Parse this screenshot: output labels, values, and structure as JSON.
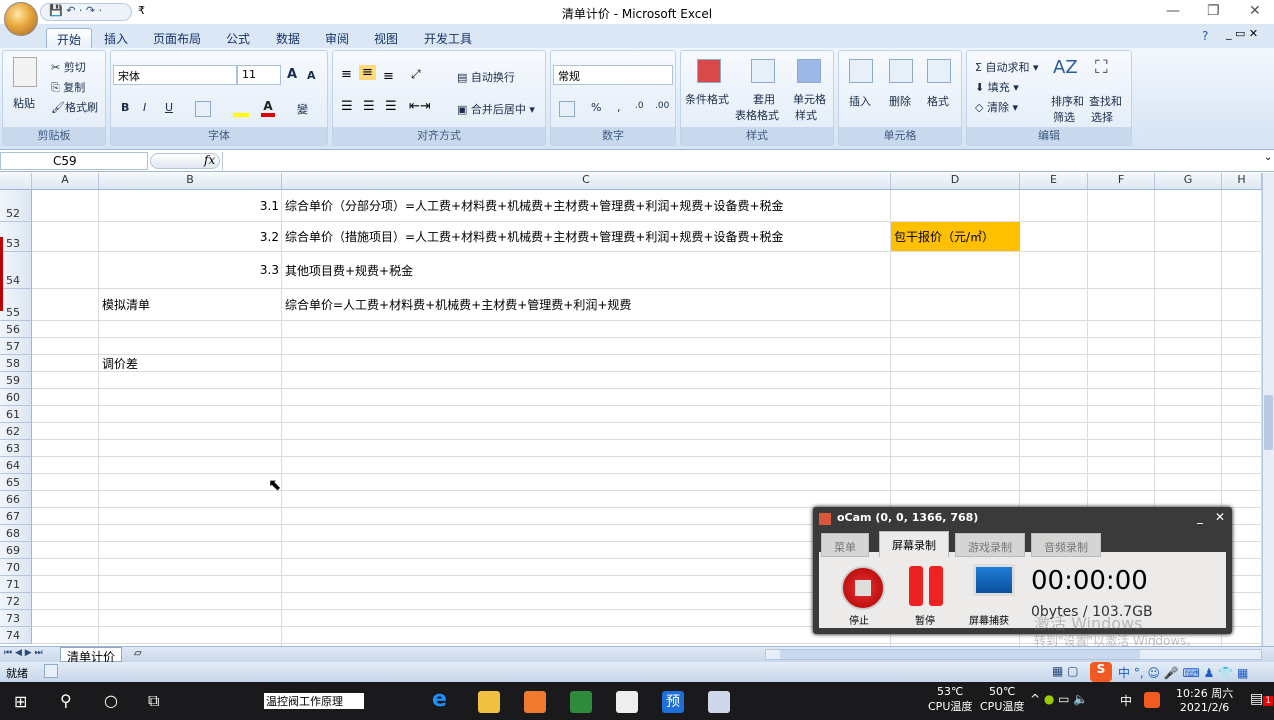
{
  "window": {
    "title": "清单计价 - Microsoft Excel",
    "min": "—",
    "max": "❐",
    "close": "✕",
    "qat": "💾 ↶ · ↷ ·",
    "qat_more": "₹"
  },
  "ribbon_tabs": [
    {
      "label": "开始",
      "active": true
    },
    {
      "label": "插入"
    },
    {
      "label": "页面布局"
    },
    {
      "label": "公式"
    },
    {
      "label": "数据"
    },
    {
      "label": "审阅"
    },
    {
      "label": "视图"
    },
    {
      "label": "开发工具"
    }
  ],
  "ribbon": {
    "clipboard": {
      "label": "剪贴板",
      "paste": "粘贴",
      "cut": "剪切",
      "copy": "复制",
      "format_painter": "格式刷"
    },
    "font": {
      "label": "字体",
      "name": "宋体",
      "size": "11",
      "bold": "B",
      "italic": "I",
      "underline": "U",
      "grow": "A",
      "shrink": "A",
      "phonetic": "變"
    },
    "alignment": {
      "label": "对齐方式",
      "wrap": "自动换行",
      "merge": "合并后居中"
    },
    "number": {
      "label": "数字",
      "format": "常规",
      "percent": "%",
      "comma": ",",
      "inc": ".0",
      "dec": ".00"
    },
    "styles": {
      "label": "样式",
      "cond": "条件格式",
      "table_1": "套用",
      "table_2": "表格格式",
      "cell_1": "单元格",
      "cell_2": "样式"
    },
    "cells": {
      "label": "单元格",
      "insert": "插入",
      "delete": "删除",
      "format": "格式"
    },
    "editing": {
      "label": "编辑",
      "autosum": "自动求和",
      "fill": "填充",
      "clear": "清除",
      "sort_1": "排序和",
      "sort_2": "筛选",
      "find_1": "查找和",
      "find_2": "选择"
    }
  },
  "formula_bar": {
    "name_box": "C59",
    "fx": "fx",
    "value": ""
  },
  "columns": [
    "A",
    "B",
    "C",
    "D",
    "E",
    "F",
    "G",
    "H"
  ],
  "rows": [
    {
      "n": "52",
      "b": "3.1",
      "c": "综合单价（分部分项）=人工费+材料费+机械费+主材费+管理费+利润+规费+设备费+税金",
      "d": ""
    },
    {
      "n": "53",
      "b": "3.2",
      "c": "综合单价（措施项目）=人工费+材料费+机械费+主材费+管理费+利润+规费+设备费+税金",
      "d": "包干报价（元/㎡）"
    },
    {
      "n": "54",
      "b": "3.3",
      "c": "其他项目费+规费+税金",
      "d": ""
    },
    {
      "n": "55",
      "bl": "模拟清单",
      "c": "综合单价=人工费+材料费+机械费+主材费+管理费+利润+规费",
      "d": ""
    },
    {
      "n": "56"
    },
    {
      "n": "57"
    },
    {
      "n": "58",
      "bl": "调价差"
    },
    {
      "n": "59"
    },
    {
      "n": "60"
    },
    {
      "n": "61"
    },
    {
      "n": "62"
    },
    {
      "n": "63"
    },
    {
      "n": "64"
    },
    {
      "n": "65"
    },
    {
      "n": "66"
    },
    {
      "n": "67"
    },
    {
      "n": "68"
    },
    {
      "n": "69"
    },
    {
      "n": "70"
    },
    {
      "n": "71"
    },
    {
      "n": "72"
    },
    {
      "n": "73"
    },
    {
      "n": "74"
    }
  ],
  "highlight_color": "#ffc000",
  "sheet_tabs": [
    {
      "label": "清单计价",
      "active": true
    }
  ],
  "status": {
    "ready": "就绪"
  },
  "ocam": {
    "title": "oCam (0, 0, 1366, 768)",
    "tabs": [
      "菜单",
      "屏幕录制",
      "游戏录制",
      "音频录制"
    ],
    "active_tab": "屏幕录制",
    "stop": "停止",
    "pause": "暂停",
    "capture": "屏幕捕获",
    "time": "00:00:00",
    "size": "0bytes / 103.7GB"
  },
  "watermark": {
    "line1": "激活 Windows",
    "line2": "转到\"设置\"以激活 Windows。"
  },
  "taskbar": {
    "search_app": "温控阀工作原理",
    "cpu1_temp": "53℃",
    "cpu1_label": "CPU温度",
    "cpu2_temp": "50℃",
    "cpu2_label": "CPU温度",
    "ime": "中",
    "time": "10:26 周六",
    "date": "2021/2/6",
    "notif": "1"
  }
}
